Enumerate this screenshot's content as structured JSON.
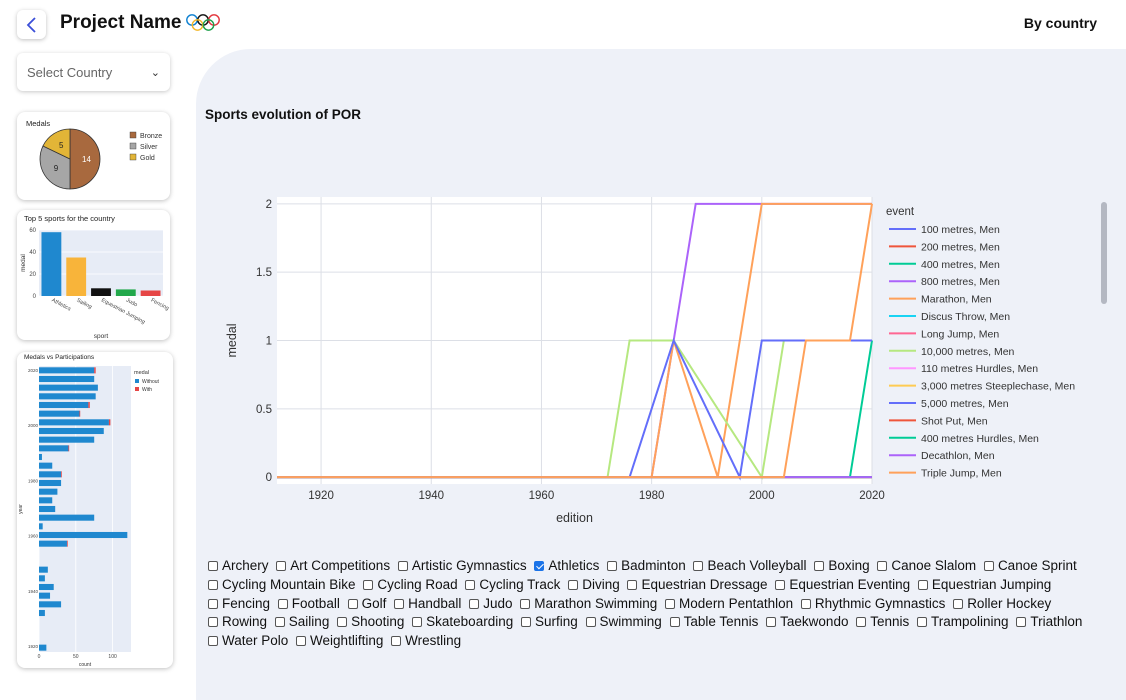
{
  "header": {
    "title": "Project Name",
    "right_label": "By country",
    "back_icon": "chevron-left-icon"
  },
  "country_select": {
    "placeholder": "Select Country"
  },
  "medals_card": {
    "title": "Medals",
    "chart_data": {
      "type": "pie",
      "labels": [
        "Bronze",
        "Silver",
        "Gold"
      ],
      "values": [
        14,
        9,
        5
      ],
      "colors": [
        "#a8693e",
        "#a6a6a6",
        "#e2b537"
      ],
      "legend": "right"
    }
  },
  "top5_card": {
    "title": "Top 5 sports for the country",
    "chart_data": {
      "type": "bar",
      "categories": [
        "Athletics",
        "Sailing",
        "Equestrian Jumping",
        "Judo",
        "Fencing"
      ],
      "values": [
        58,
        35,
        7,
        6,
        5
      ],
      "colors": [
        "#1f88cf",
        "#f8b43a",
        "#111111",
        "#22a84b",
        "#e64646"
      ],
      "xlabel": "sport",
      "ylabel": "medal",
      "ylim": [
        0,
        60
      ],
      "yticks": [
        0,
        20,
        40,
        60
      ]
    }
  },
  "participation_card": {
    "title": "Medals vs Participations",
    "chart_data": {
      "type": "bar",
      "orientation": "horizontal",
      "xlabel": "count",
      "ylabel": "year",
      "xlim": [
        0,
        125
      ],
      "xticks": [
        0,
        50,
        100
      ],
      "yticks": [
        "2020",
        "2000",
        "1980",
        "1960",
        "1940",
        "1920"
      ],
      "legend_title": "medal",
      "series": [
        {
          "name": "Without",
          "color": "#1f88cf",
          "values": [
            75,
            75,
            80,
            77,
            67,
            55,
            95,
            88,
            75,
            40,
            4,
            18,
            30,
            30,
            25,
            18,
            22,
            75,
            5,
            120,
            38,
            0,
            0,
            12,
            8,
            20,
            15,
            30,
            8,
            0,
            0,
            0,
            10
          ]
        },
        {
          "name": "With",
          "color": "#e64646",
          "values": [
            2,
            0,
            0,
            0,
            2,
            1,
            2,
            0,
            0,
            1,
            0,
            0,
            1,
            0,
            0,
            0,
            0,
            0,
            0,
            0,
            1,
            0,
            0,
            0,
            0,
            0,
            0,
            0,
            0,
            0,
            0,
            0,
            0
          ]
        }
      ]
    }
  },
  "main": {
    "title": "Sports evolution of POR",
    "chart_data": {
      "type": "line",
      "xlabel": "edition",
      "ylabel": "medal",
      "xlim": [
        1912,
        2020
      ],
      "ylim": [
        -0.05,
        2.05
      ],
      "xticks": [
        1920,
        1940,
        1960,
        1980,
        2000,
        2020
      ],
      "yticks": [
        0,
        0.5,
        1,
        1.5,
        2
      ],
      "legend_title": "event",
      "series": [
        {
          "name": "100 metres, Men",
          "color": "#636efa",
          "x": [
            1912,
            2020
          ],
          "y": [
            0,
            0
          ]
        },
        {
          "name": "200 metres, Men",
          "color": "#ef553b",
          "x": [
            1912,
            2020
          ],
          "y": [
            0,
            0
          ]
        },
        {
          "name": "400 metres, Men",
          "color": "#00cc96",
          "x": [
            1912,
            2016,
            2020
          ],
          "y": [
            0,
            0,
            1
          ]
        },
        {
          "name": "800 metres, Men",
          "color": "#ab63fa",
          "x": [
            1912,
            1980,
            1988,
            2016,
            2020
          ],
          "y": [
            0,
            0,
            2,
            2,
            2
          ]
        },
        {
          "name": "Marathon, Men",
          "color": "#ffa15a",
          "x": [
            1912,
            1980,
            1984,
            1992,
            2000,
            2016,
            2020
          ],
          "y": [
            0,
            0,
            1,
            0,
            2,
            2,
            2
          ]
        },
        {
          "name": "Discus Throw, Men",
          "color": "#19d3f3",
          "x": [
            1912,
            2020
          ],
          "y": [
            0,
            0
          ]
        },
        {
          "name": "Long Jump, Men",
          "color": "#ff6692",
          "x": [
            1912,
            2020
          ],
          "y": [
            0,
            0
          ]
        },
        {
          "name": "10,000 metres, Men",
          "color": "#b6e880",
          "x": [
            1912,
            1972,
            1976,
            1984,
            2000,
            2004,
            2020
          ],
          "y": [
            0,
            0,
            1,
            1,
            0,
            1,
            1
          ]
        },
        {
          "name": "110 metres Hurdles, Men",
          "color": "#ff97ff",
          "x": [
            1912,
            2020
          ],
          "y": [
            0,
            0
          ]
        },
        {
          "name": "3,000 metres Steeplechase, Men",
          "color": "#fecb52",
          "x": [
            1912,
            2020
          ],
          "y": [
            0,
            0
          ]
        },
        {
          "name": "5,000 metres, Men",
          "color": "#636efa",
          "x": [
            1912,
            1976,
            1984,
            1996,
            2000,
            2020
          ],
          "y": [
            0,
            0,
            1,
            0,
            1,
            1
          ]
        },
        {
          "name": "Shot Put, Men",
          "color": "#ef553b",
          "x": [
            1912,
            2020
          ],
          "y": [
            0,
            0
          ]
        },
        {
          "name": "400 metres Hurdles, Men",
          "color": "#00cc96",
          "x": [
            1912,
            2020
          ],
          "y": [
            0,
            0
          ]
        },
        {
          "name": "Decathlon, Men",
          "color": "#ab63fa",
          "x": [
            1912,
            2020
          ],
          "y": [
            0,
            0
          ]
        },
        {
          "name": "Triple Jump, Men",
          "color": "#ffa15a",
          "x": [
            1912,
            2004,
            2008,
            2016,
            2020
          ],
          "y": [
            0,
            0,
            1,
            1,
            2
          ]
        }
      ]
    }
  },
  "sports": [
    {
      "label": "Archery",
      "checked": false
    },
    {
      "label": "Art Competitions",
      "checked": false
    },
    {
      "label": "Artistic Gymnastics",
      "checked": false
    },
    {
      "label": "Athletics",
      "checked": true
    },
    {
      "label": "Badminton",
      "checked": false
    },
    {
      "label": "Beach Volleyball",
      "checked": false
    },
    {
      "label": "Boxing",
      "checked": false
    },
    {
      "label": "Canoe Slalom",
      "checked": false
    },
    {
      "label": "Canoe Sprint",
      "checked": false
    },
    {
      "label": "Cycling Mountain Bike",
      "checked": false
    },
    {
      "label": "Cycling Road",
      "checked": false
    },
    {
      "label": "Cycling Track",
      "checked": false
    },
    {
      "label": "Diving",
      "checked": false
    },
    {
      "label": "Equestrian Dressage",
      "checked": false
    },
    {
      "label": "Equestrian Eventing",
      "checked": false
    },
    {
      "label": "Equestrian Jumping",
      "checked": false
    },
    {
      "label": "Fencing",
      "checked": false
    },
    {
      "label": "Football",
      "checked": false
    },
    {
      "label": "Golf",
      "checked": false
    },
    {
      "label": "Handball",
      "checked": false
    },
    {
      "label": "Judo",
      "checked": false
    },
    {
      "label": "Marathon Swimming",
      "checked": false
    },
    {
      "label": "Modern Pentathlon",
      "checked": false
    },
    {
      "label": "Rhythmic Gymnastics",
      "checked": false
    },
    {
      "label": "Roller Hockey",
      "checked": false
    },
    {
      "label": "Rowing",
      "checked": false
    },
    {
      "label": "Sailing",
      "checked": false
    },
    {
      "label": "Shooting",
      "checked": false
    },
    {
      "label": "Skateboarding",
      "checked": false
    },
    {
      "label": "Surfing",
      "checked": false
    },
    {
      "label": "Swimming",
      "checked": false
    },
    {
      "label": "Table Tennis",
      "checked": false
    },
    {
      "label": "Taekwondo",
      "checked": false
    },
    {
      "label": "Tennis",
      "checked": false
    },
    {
      "label": "Trampolining",
      "checked": false
    },
    {
      "label": "Triathlon",
      "checked": false
    },
    {
      "label": "Water Polo",
      "checked": false
    },
    {
      "label": "Weightlifting",
      "checked": false
    },
    {
      "label": "Wrestling",
      "checked": false
    }
  ]
}
